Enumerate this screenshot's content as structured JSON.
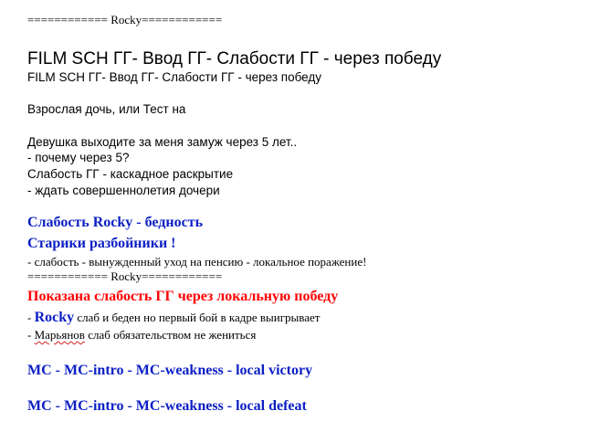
{
  "document": {
    "sep1": "============ Rocky============",
    "heading": "FILM SCH ГГ- Ввод ГГ- Слабости ГГ - через победу",
    "heading_small": "FILM SCH ГГ- Ввод ГГ- Слабости ГГ - через победу",
    "adult_daughter": "Взрослая дочь, или Тест на",
    "quote_line": "Девушка выходите за меня замуж через 5 лет..",
    "why_five": "- почему через 5?",
    "cascade": "Слабость ГГ - каскадное раскрытие",
    "wait": "- ждать совершеннолетия дочери",
    "rocky_weakness": "Слабость Rocky - бедность",
    "old_robbers": "Старики разбойники !",
    "forced_retirement": "- слабость - вынужденный уход на пенсию - локальное поражение!",
    "sep2": "============ Rocky============",
    "shown_weakness": "Показана слабость ГГ через локальную победу",
    "rocky_line_dash": "- ",
    "rocky_name": "Rocky",
    "rocky_line_rest": " слаб и беден но первый бой в кадре выигрывает",
    "maryanov_dash": "- ",
    "maryanov_name": "Марьянов",
    "maryanov_rest": " слаб обязательством не жениться",
    "mc_victory": "MC - MC-intro - MC-weakness - local victory",
    "mc_defeat": "MC - MC-intro - MC-weakness - local defeat"
  },
  "colors": {
    "blue": "#0b1fc4",
    "red": "#ff0000",
    "text": "#000000"
  }
}
